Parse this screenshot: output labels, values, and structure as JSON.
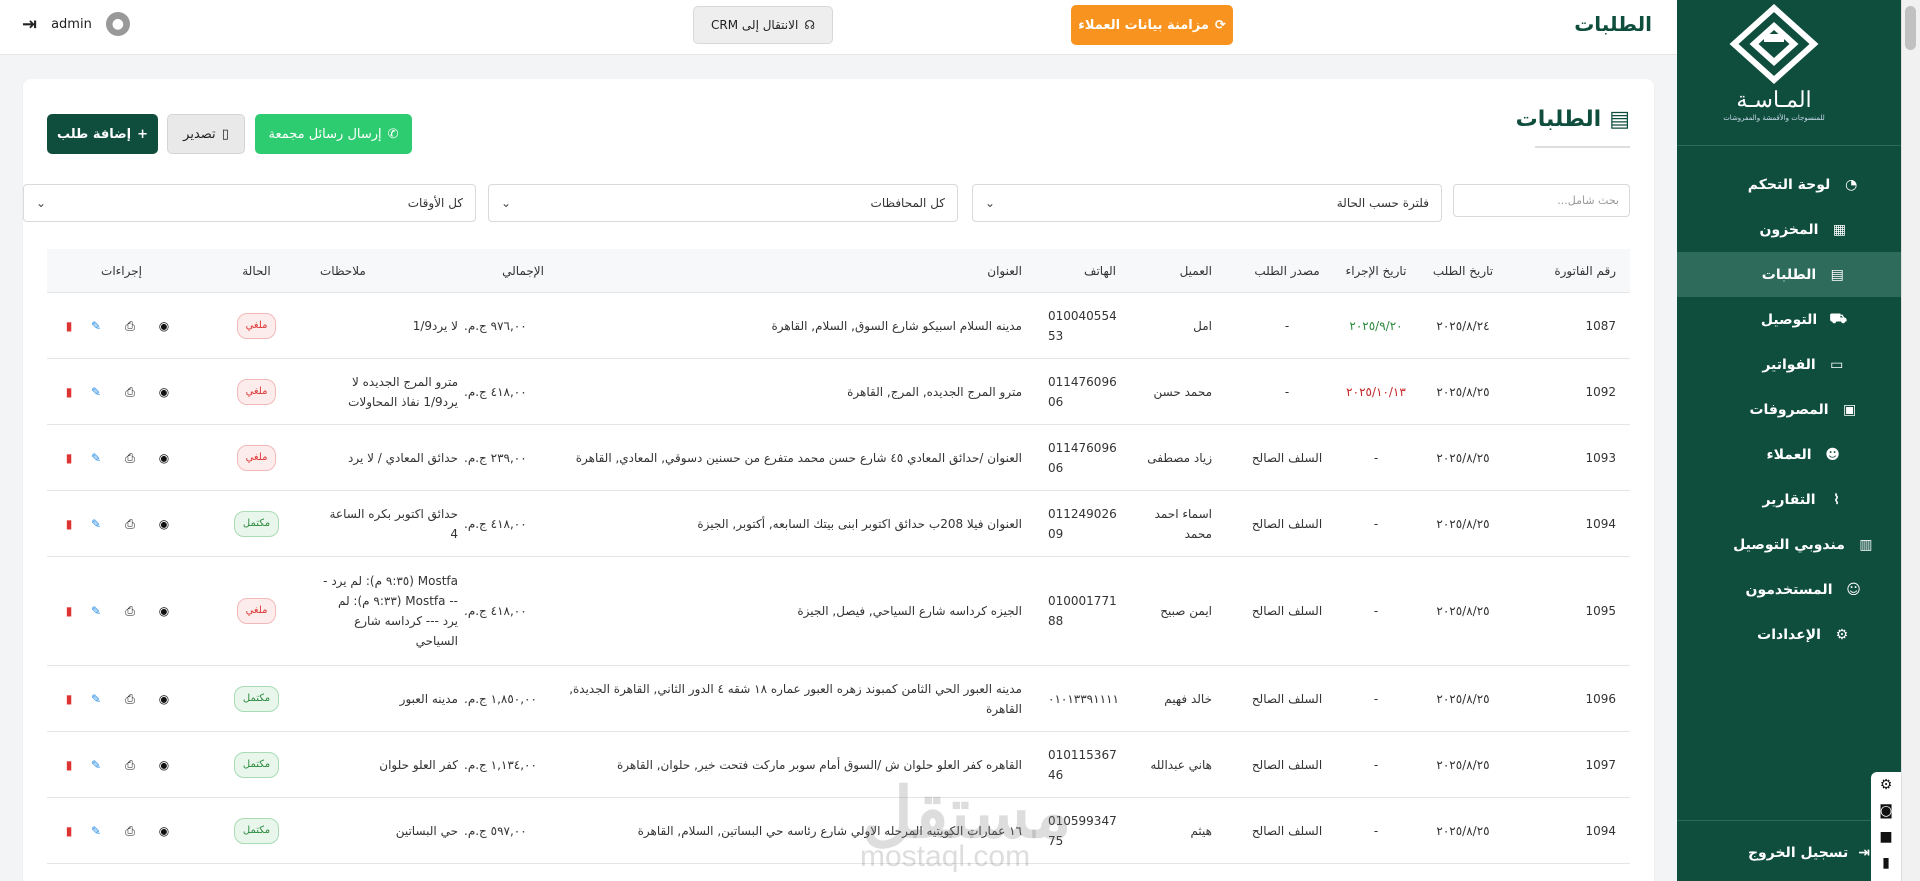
{
  "topbar": {
    "title": "الطلبات",
    "sync_label": "مزامنة بيانات العملاء",
    "crm_label": "الانتقال إلى CRM",
    "username": "admin"
  },
  "sidebar": {
    "brand": "المـاسـة",
    "brand_sub": "للمنسوجات والأقمشة والمفروشات",
    "items": [
      {
        "label": "لوحة التحكم",
        "icon": "dashboard-icon"
      },
      {
        "label": "المخزون",
        "icon": "boxes-icon"
      },
      {
        "label": "الطلبات",
        "icon": "orders-icon"
      },
      {
        "label": "التوصيل",
        "icon": "truck-icon"
      },
      {
        "label": "الفواتير",
        "icon": "invoice-icon"
      },
      {
        "label": "المصروفات",
        "icon": "money-icon"
      },
      {
        "label": "العملاء",
        "icon": "users-icon"
      },
      {
        "label": "التقارير",
        "icon": "chart-icon"
      },
      {
        "label": "مندوبي التوصيل",
        "icon": "id-card-icon"
      },
      {
        "label": "المستخدمون",
        "icon": "user-gear-icon"
      },
      {
        "label": "الإعدادات",
        "icon": "gear-icon"
      }
    ],
    "logout_label": "تسجيل الخروج"
  },
  "main": {
    "title": "الطلبات",
    "add_label": "إضافة طلب",
    "export_label": "تصدير",
    "whatsapp_label": "إرسال رسائل مجمعة",
    "search_placeholder": "بحث شامل...",
    "status_filter": "فلترة حسب الحالة",
    "gov_filter": "كل المحافظات",
    "time_filter": "كل الأوقات"
  },
  "table": {
    "headers": [
      "رقم الفاتورة",
      "تاريخ الطلب",
      "تاريخ الإجراء",
      "مصدر الطلب",
      "العميل",
      "الهاتف",
      "العنوان",
      "الإجمالي",
      "ملاحظات",
      "الحالة",
      "إجراءات"
    ],
    "rows": [
      {
        "invoice": "1087",
        "order_date": "٢٠٢٥/٨/٢٤",
        "action_date": "٢٠٢٥/٩/٢٠",
        "action_color": "green",
        "source": "-",
        "client": "امل",
        "phone": "010040554\n53",
        "address": "مدينه السلام اسبيكو شارع السوق, السلام, القاهرة",
        "total": "٩٧٦,٠٠ ج.م.",
        "notes": "لا يرد1/9",
        "status": "ملغي",
        "status_type": "cancel"
      },
      {
        "invoice": "1092",
        "order_date": "٢٠٢٥/٨/٢٥",
        "action_date": "٢٠٢٥/١٠/١٣",
        "action_color": "red",
        "source": "-",
        "client": "محمد حسن",
        "phone": "011476096\n06",
        "address": "مترو المرج الجديده, المرج, القاهرة",
        "total": "٤١٨,٠٠ ج.م.",
        "notes": "مترو المرج الجديده لا يرد1/9 نفاذ المحاولات",
        "status": "ملغي",
        "status_type": "cancel"
      },
      {
        "invoice": "1093",
        "order_date": "٢٠٢٥/٨/٢٥",
        "action_date": "-",
        "action_color": "",
        "source": "السلف الصالح",
        "client": "زياد مصطفى",
        "phone": "011476096\n06",
        "address": "العنوان /حدائق المعادي ٤٥ شارع حسن محمد متفرع من حسنين دسوقي, المعادي, القاهرة",
        "total": "٢٣٩,٠٠ ج.م.",
        "notes": "حدائق المعادي / لا يرد",
        "status": "ملغي",
        "status_type": "cancel"
      },
      {
        "invoice": "1094",
        "order_date": "٢٠٢٥/٨/٢٥",
        "action_date": "-",
        "action_color": "",
        "source": "السلف الصالح",
        "client": "اسماء احمد محمد",
        "phone": "011249026\n09",
        "address": "العنوان فيلا 208ب حدائق اكتوبر ابنى بيتك السابعه, أكتوبر, الجيزة",
        "total": "٤١٨,٠٠ ج.م.",
        "notes": "حدائق اكتوبر بكره الساعة 4",
        "status": "مكتمل",
        "status_type": "done"
      },
      {
        "invoice": "1095",
        "order_date": "٢٠٢٥/٨/٢٥",
        "action_date": "-",
        "action_color": "",
        "source": "السلف الصالح",
        "client": "ايمن صبيح",
        "phone": "010001771\n88",
        "address": "الجيزه كرداسه شارع السياحي, فيصل, الجيزة",
        "total": "٤١٨,٠٠ ج.م.",
        "notes": "Mostfa (٩:٣٥ م): لم يرد --- Mostfa (٩:٣٣ م): لم يرد --- كرداسه شارع السياحي",
        "status": "ملغي",
        "status_type": "cancel"
      },
      {
        "invoice": "1096",
        "order_date": "٢٠٢٥/٨/٢٥",
        "action_date": "-",
        "action_color": "",
        "source": "السلف الصالح",
        "client": "خالد فهيم",
        "phone": "٠١٠١٣٣٩١١١١",
        "address": "مدينه العبور الحي الثامن كمبوند زهره العبور عماره ١٨ شقه ٤ الدور الثاني, القاهرة الجديدة, القاهرة",
        "total": "١,٨٥٠,٠٠ ج.م.",
        "notes": "مدينه العبور",
        "status": "مكتمل",
        "status_type": "done"
      },
      {
        "invoice": "1097",
        "order_date": "٢٠٢٥/٨/٢٥",
        "action_date": "-",
        "action_color": "",
        "source": "السلف الصالح",
        "client": "هاني عبدالله",
        "phone": "010115367\n46",
        "address": "القاهره كفر العلو حلوان ش /السوق أمام سوبر ماركت فتحت خير, حلوان, القاهرة",
        "total": "١,١٣٤,٠٠ ج.م.",
        "notes": "كفر العلو حلوان",
        "status": "مكتمل",
        "status_type": "done"
      },
      {
        "invoice": "1094",
        "order_date": "٢٠٢٥/٨/٢٥",
        "action_date": "-",
        "action_color": "",
        "source": "السلف الصالح",
        "client": "هيثم",
        "phone": "010599347\n75",
        "address": "١٦ عمارات الكويتيه المرحله الاولي شارع رئاسه حي البساتين, السلام, القاهرة",
        "total": "٥٩٧,٠٠ ج.م.",
        "notes": "حي البساتين",
        "status": "مكتمل",
        "status_type": "done"
      }
    ]
  },
  "watermark": {
    "main": "مستقل",
    "sub": "mostaql.com"
  }
}
